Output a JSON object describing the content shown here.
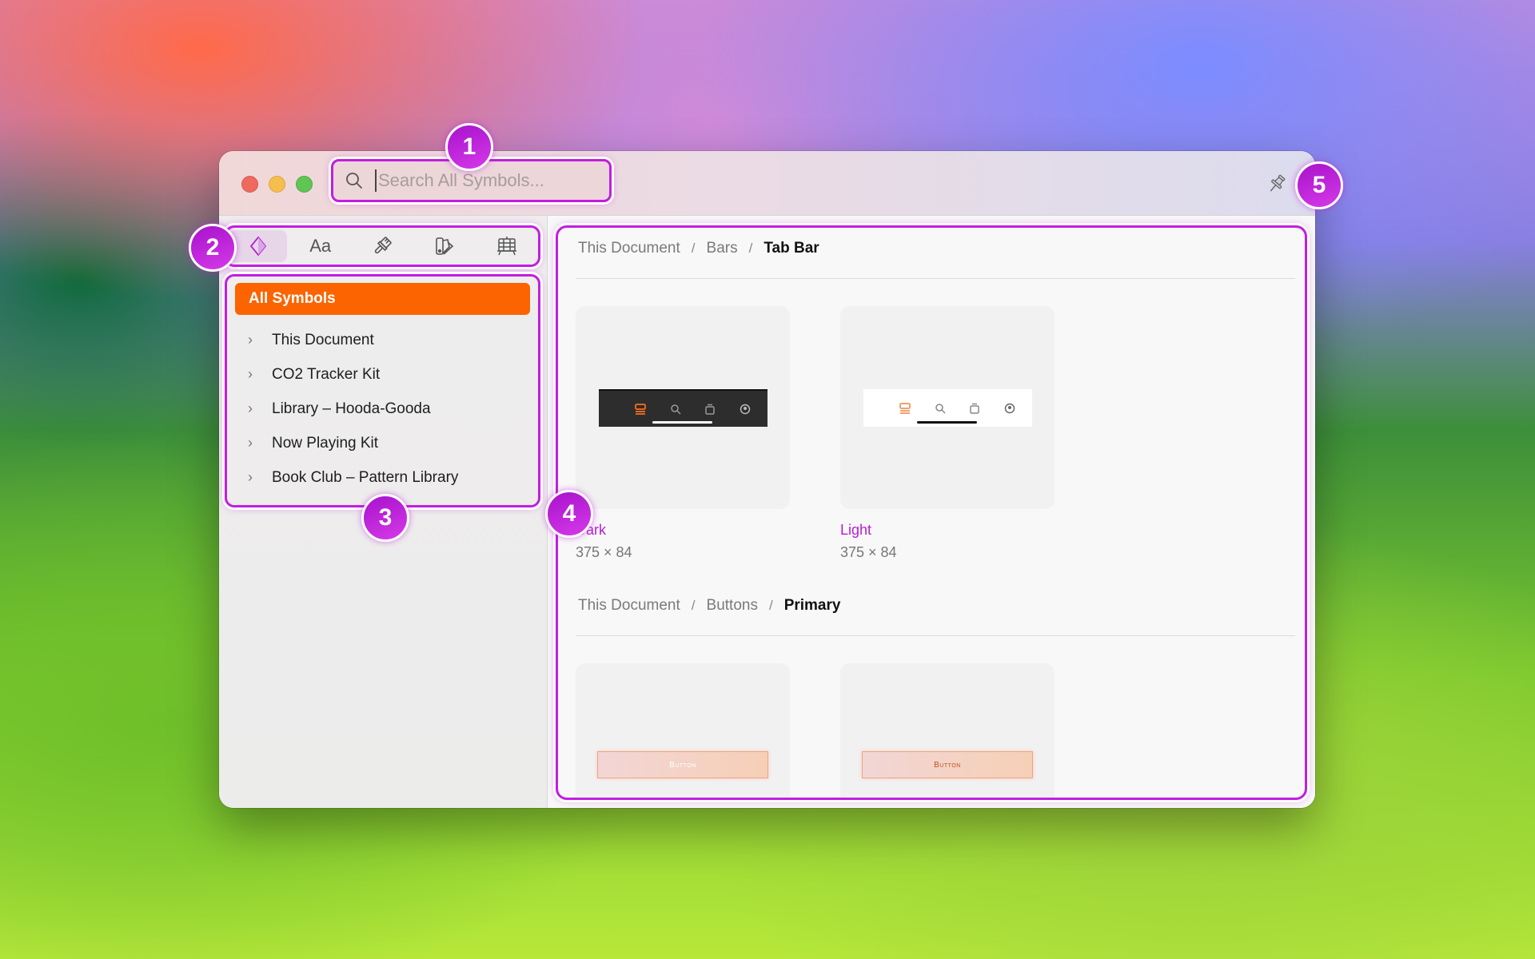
{
  "window": {
    "search": {
      "placeholder": "Search All Symbols...",
      "value": ""
    },
    "pin_icon": "pushpin-icon"
  },
  "sidebar": {
    "icon_tabs": [
      {
        "name": "symbols",
        "icon": "diamond-icon",
        "glyph": "◇",
        "active": true
      },
      {
        "name": "text-styles",
        "icon": "text-styles-icon",
        "glyph": "Aa",
        "active": false
      },
      {
        "name": "layer-styles",
        "icon": "paintbrush-icon",
        "glyph": "",
        "active": false
      },
      {
        "name": "color-variables",
        "icon": "swatches-icon",
        "glyph": "",
        "active": false
      },
      {
        "name": "templates",
        "icon": "artboard-icon",
        "glyph": "",
        "active": false
      }
    ],
    "all_symbols_label": "All Symbols",
    "libraries": [
      {
        "label": "This Document"
      },
      {
        "label": "CO2 Tracker Kit"
      },
      {
        "label": "Library – Hooda-Gooda"
      },
      {
        "label": "Now Playing Kit"
      },
      {
        "label": "Book Club – Pattern Library"
      }
    ]
  },
  "content": {
    "sections": [
      {
        "breadcrumb": [
          "This Document",
          "Bars",
          "Tab Bar"
        ],
        "separator": "/",
        "symbols": [
          {
            "name": "Dark",
            "dims": "375 × 84"
          },
          {
            "name": "Light",
            "dims": "375 × 84"
          }
        ]
      },
      {
        "breadcrumb": [
          "This Document",
          "Buttons",
          "Primary"
        ],
        "separator": "/",
        "symbols": [
          {
            "preview_label": "Button"
          },
          {
            "preview_label": "Button"
          }
        ]
      }
    ]
  },
  "annotations": [
    "1",
    "2",
    "3",
    "4",
    "5"
  ],
  "colors": {
    "accent": "#fb6400",
    "highlight": "#c21ee0",
    "symbol_name": "#b51fd0"
  }
}
